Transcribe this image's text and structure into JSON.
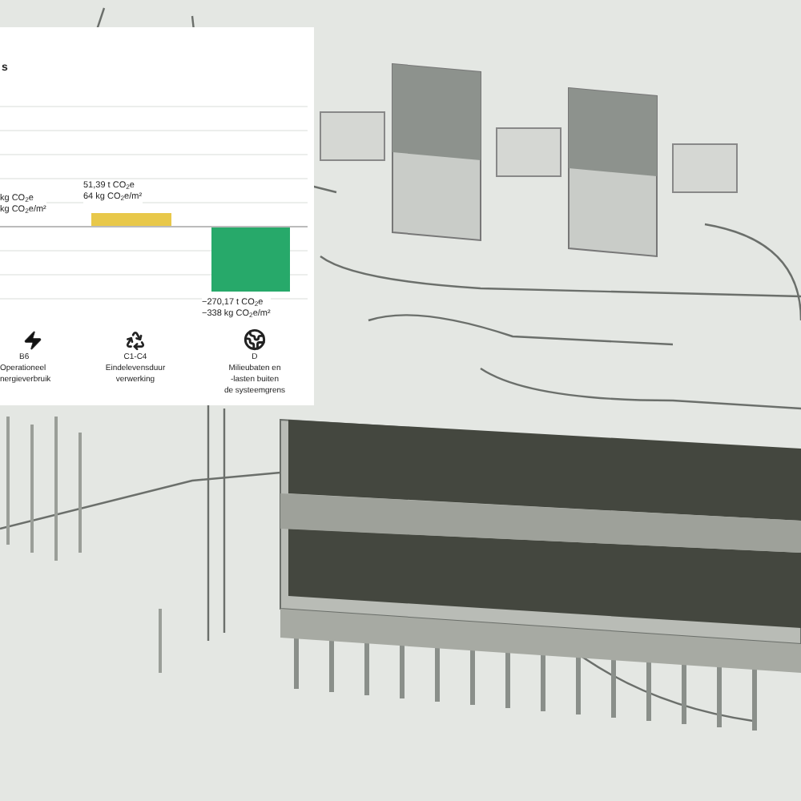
{
  "panel": {
    "title": "s",
    "columns": [
      {
        "kind": "label_only",
        "value_lines": [
          "kg CO$_{2}$e",
          "kg CO$_{2}$e/m²"
        ],
        "label_lines": [
          "B6",
          "Operationeel",
          "nergieverbruik"
        ]
      },
      {
        "kind": "positive",
        "value_lines": [
          "51,39 t CO$_{2}$e",
          "64 kg CO$_{2}$e/m²"
        ],
        "color": "#e8c84a",
        "label_lines": [
          "C1-C4",
          "Eindelevensduur",
          "verwerking"
        ]
      },
      {
        "kind": "negative",
        "value_lines": [
          "−270,17 t CO$_{2}$e",
          "−338 kg CO$_{2}$e/m²"
        ],
        "color": "#27a96a",
        "label_lines": [
          "D",
          "Milieubaten en",
          "-lasten buiten",
          "de systeemgrens"
        ]
      }
    ]
  }
}
